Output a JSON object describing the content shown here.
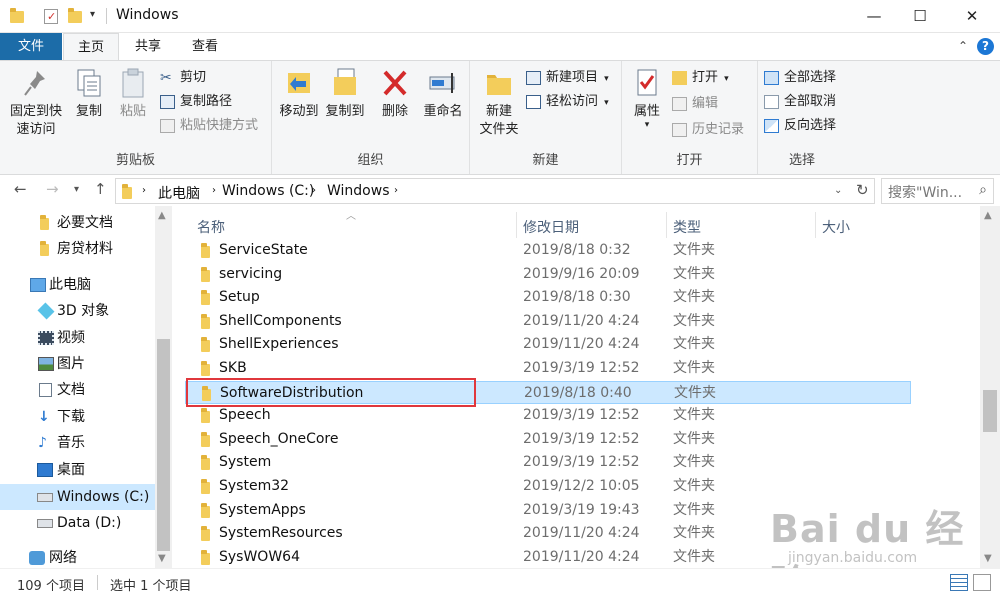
{
  "window": {
    "title": "Windows",
    "minimize_glyph": "—",
    "maximize_glyph": "☐",
    "close_glyph": "✕"
  },
  "ribbon_tabs": {
    "file": "文件",
    "home": "主页",
    "share": "共享",
    "view": "查看"
  },
  "ribbon": {
    "clipboard": {
      "label": "剪贴板",
      "pin": "固定到快速访问",
      "pin_line1": "固定到快",
      "pin_line2": "速访问",
      "copy": "复制",
      "paste": "粘贴",
      "cut": "剪切",
      "copy_path": "复制路径",
      "paste_shortcut": "粘贴快捷方式"
    },
    "organize": {
      "label": "组织",
      "move_to": "移动到",
      "copy_to": "复制到",
      "delete": "删除",
      "rename": "重命名"
    },
    "new": {
      "label": "新建",
      "new_folder_line1": "新建",
      "new_folder_line2": "文件夹",
      "new_item": "新建项目",
      "easy_access": "轻松访问"
    },
    "open": {
      "label": "打开",
      "properties": "属性",
      "open": "打开",
      "edit": "编辑",
      "history": "历史记录"
    },
    "select": {
      "label": "选择",
      "select_all": "全部选择",
      "select_none": "全部取消",
      "invert": "反向选择"
    }
  },
  "address": {
    "crumbs": [
      "此电脑",
      "Windows (C:)",
      "Windows"
    ],
    "search_placeholder": "搜索\"Win..."
  },
  "sidebar": {
    "items": [
      {
        "label": "必要文档",
        "icon": "folder-icon"
      },
      {
        "label": "房贷材料",
        "icon": "folder-icon"
      },
      {
        "label": "此电脑",
        "icon": "pc-icon"
      },
      {
        "label": "3D 对象",
        "icon": "cube-icon"
      },
      {
        "label": "视频",
        "icon": "video-icon"
      },
      {
        "label": "图片",
        "icon": "picture-icon"
      },
      {
        "label": "文档",
        "icon": "document-icon"
      },
      {
        "label": "下载",
        "icon": "download-icon"
      },
      {
        "label": "音乐",
        "icon": "music-icon"
      },
      {
        "label": "桌面",
        "icon": "desktop-icon"
      },
      {
        "label": "Windows (C:)",
        "icon": "drive-icon"
      },
      {
        "label": "Data (D:)",
        "icon": "drive-icon"
      },
      {
        "label": "网络",
        "icon": "network-icon"
      }
    ]
  },
  "columns": {
    "name": "名称",
    "date": "修改日期",
    "type": "类型",
    "size": "大小"
  },
  "files": [
    {
      "name": "ServiceState",
      "date": "2019/8/18 0:32",
      "type": "文件夹"
    },
    {
      "name": "servicing",
      "date": "2019/9/16 20:09",
      "type": "文件夹"
    },
    {
      "name": "Setup",
      "date": "2019/8/18 0:30",
      "type": "文件夹"
    },
    {
      "name": "ShellComponents",
      "date": "2019/11/20 4:24",
      "type": "文件夹"
    },
    {
      "name": "ShellExperiences",
      "date": "2019/11/20 4:24",
      "type": "文件夹"
    },
    {
      "name": "SKB",
      "date": "2019/3/19 12:52",
      "type": "文件夹"
    },
    {
      "name": "SoftwareDistribution",
      "date": "2019/8/18 0:40",
      "type": "文件夹"
    },
    {
      "name": "Speech",
      "date": "2019/3/19 12:52",
      "type": "文件夹"
    },
    {
      "name": "Speech_OneCore",
      "date": "2019/3/19 12:52",
      "type": "文件夹"
    },
    {
      "name": "System",
      "date": "2019/3/19 12:52",
      "type": "文件夹"
    },
    {
      "name": "System32",
      "date": "2019/12/2 10:05",
      "type": "文件夹"
    },
    {
      "name": "SystemApps",
      "date": "2019/3/19 19:43",
      "type": "文件夹"
    },
    {
      "name": "SystemResources",
      "date": "2019/11/20 4:24",
      "type": "文件夹"
    },
    {
      "name": "SysWOW64",
      "date": "2019/11/20 4:24",
      "type": "文件夹"
    }
  ],
  "status": {
    "count": "109 个项目",
    "selected": "选中 1 个项目"
  },
  "watermark": {
    "brand": "Bai du 经验",
    "url": "jingyan.baidu.com"
  },
  "colors": {
    "accent": "#1c6ca8",
    "selection": "#cce8ff",
    "highlight_box": "#e0373c"
  }
}
